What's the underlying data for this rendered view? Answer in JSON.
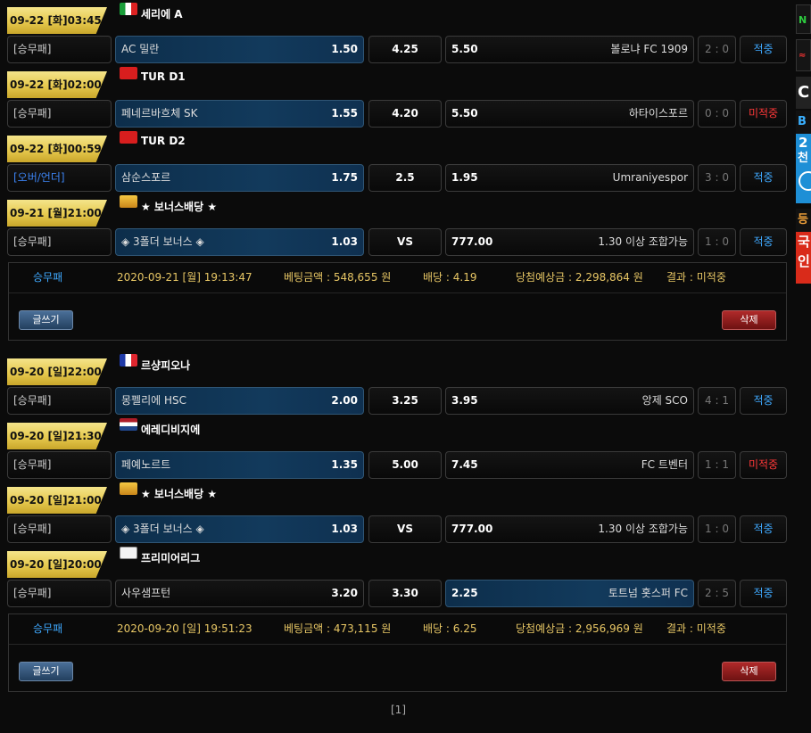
{
  "bets": [
    {
      "games": [
        {
          "datetime": "09-22 [화]03:45",
          "league": "세리에 A",
          "flag": "it",
          "type": "[승무패]",
          "type_color": "normal",
          "home": "AC 밀란",
          "home_odds": "1.50",
          "draw": "4.25",
          "away_odds": "5.50",
          "away": "볼로냐 FC 1909",
          "score": "2 : 0",
          "result": "적중",
          "result_status": "hit",
          "selected": "home"
        },
        {
          "datetime": "09-22 [화]02:00",
          "league": "TUR D1",
          "flag": "tr",
          "type": "[승무패]",
          "type_color": "normal",
          "home": "페네르바흐체 SK",
          "home_odds": "1.55",
          "draw": "4.20",
          "away_odds": "5.50",
          "away": "하타이스포르",
          "score": "0 : 0",
          "result": "미적중",
          "result_status": "miss",
          "selected": "home"
        },
        {
          "datetime": "09-22 [화]00:59",
          "league": "TUR D2",
          "flag": "tr",
          "type": "[오버/언더]",
          "type_color": "blue",
          "home": "삼순스포르",
          "home_odds": "1.75",
          "draw": "2.5",
          "away_odds": "1.95",
          "away": "Umraniyespor",
          "score": "3 : 0",
          "result": "적중",
          "result_status": "hit",
          "selected": "home"
        },
        {
          "datetime": "09-21 [월]21:00",
          "league": "★ 보너스배당 ★",
          "flag": "bonus",
          "type": "[승무패]",
          "type_color": "normal",
          "home": "◈ 3폴더 보너스 ◈",
          "home_odds": "1.03",
          "draw": "VS",
          "away_odds": "777.00",
          "away": "1.30 이상 조합가능",
          "score": "1 : 0",
          "result": "적중",
          "result_status": "hit",
          "selected": "home"
        }
      ],
      "summary": {
        "type": "승무패",
        "date": "2020-09-21 [월] 19:13:47",
        "amount": "베팅금액 : 548,655 원",
        "odds": "배당 : 4.19",
        "expected": "당첨예상금 : 2,298,864 원",
        "result": "결과 : 미적중"
      }
    },
    {
      "games": [
        {
          "datetime": "09-20 [일]22:00",
          "league": "르샹피오나",
          "flag": "fr",
          "type": "[승무패]",
          "type_color": "normal",
          "home": "몽펠리에 HSC",
          "home_odds": "2.00",
          "draw": "3.25",
          "away_odds": "3.95",
          "away": "앙제 SCO",
          "score": "4 : 1",
          "result": "적중",
          "result_status": "hit",
          "selected": "home"
        },
        {
          "datetime": "09-20 [일]21:30",
          "league": "에레디비지에",
          "flag": "nl",
          "type": "[승무패]",
          "type_color": "normal",
          "home": "페예노르트",
          "home_odds": "1.35",
          "draw": "5.00",
          "away_odds": "7.45",
          "away": "FC 트벤터",
          "score": "1 : 1",
          "result": "미적중",
          "result_status": "miss",
          "selected": "home"
        },
        {
          "datetime": "09-20 [일]21:00",
          "league": "★ 보너스배당 ★",
          "flag": "bonus",
          "type": "[승무패]",
          "type_color": "normal",
          "home": "◈ 3폴더 보너스 ◈",
          "home_odds": "1.03",
          "draw": "VS",
          "away_odds": "777.00",
          "away": "1.30 이상 조합가능",
          "score": "1 : 0",
          "result": "적중",
          "result_status": "hit",
          "selected": "home"
        },
        {
          "datetime": "09-20 [일]20:00",
          "league": "프리미어리그",
          "flag": "en",
          "type": "[승무패]",
          "type_color": "normal",
          "home": "사우샘프턴",
          "home_odds": "3.20",
          "draw": "3.30",
          "away_odds": "2.25",
          "away": "토트넘 홋스퍼 FC",
          "score": "2 : 5",
          "result": "적중",
          "result_status": "hit",
          "selected": "away"
        }
      ],
      "summary": {
        "type": "승무패",
        "date": "2020-09-20 [일] 19:51:23",
        "amount": "베팅금액 : 473,115 원",
        "odds": "배당 : 6.25",
        "expected": "당첨예상금 : 2,956,969 원",
        "result": "결과 : 미적중"
      }
    }
  ],
  "buttons": {
    "write": "글쓰기",
    "delete": "삭제"
  },
  "pagination": "[1]",
  "colors": {
    "hit": "#3fa9ff",
    "miss": "#ff3838",
    "gold": "#e8c765",
    "selected_bg": "#123a5c"
  }
}
